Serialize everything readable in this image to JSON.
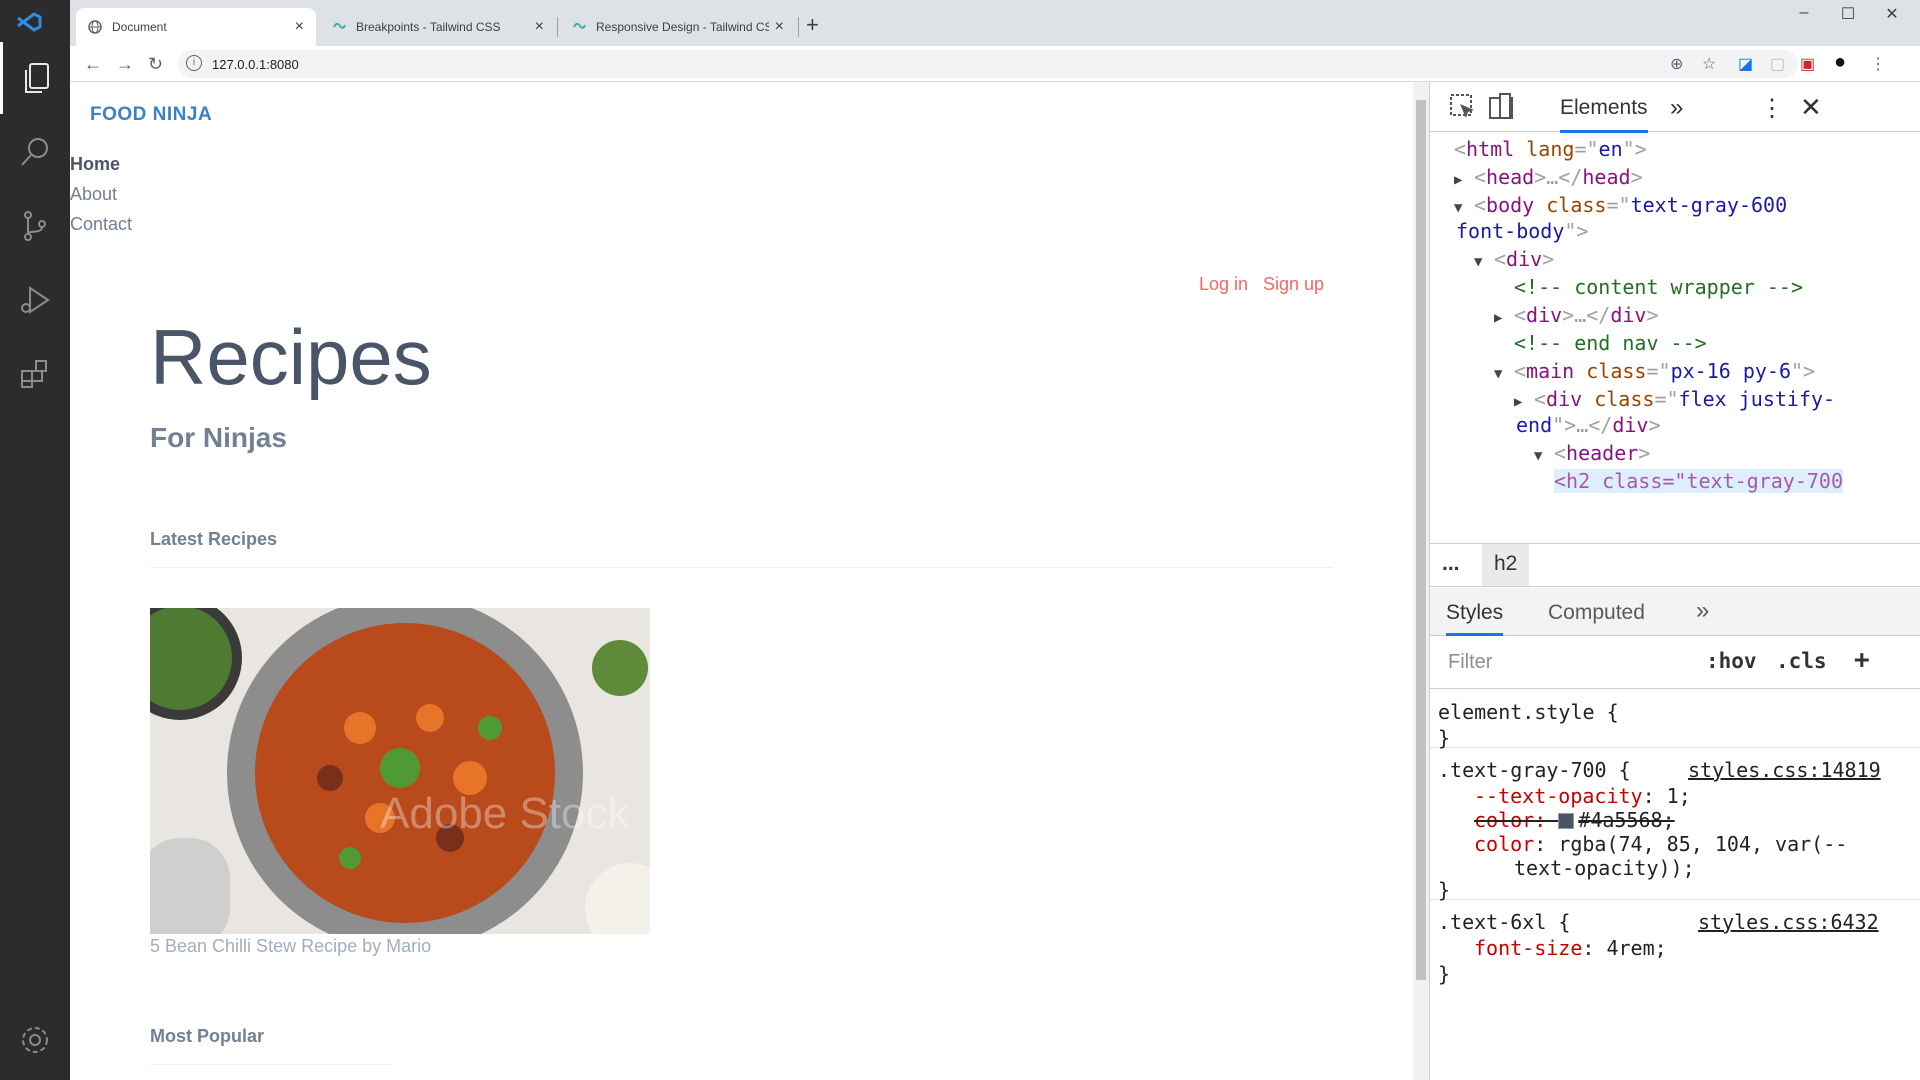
{
  "activity_bar": {
    "items": [
      {
        "name": "explorer-icon",
        "active": true
      },
      {
        "name": "search-icon",
        "active": false
      },
      {
        "name": "source-control-icon",
        "active": false
      },
      {
        "name": "run-debug-icon",
        "active": false
      },
      {
        "name": "extensions-icon",
        "active": false
      },
      {
        "name": "settings-gear-icon",
        "active": false
      }
    ]
  },
  "browser": {
    "tabs": [
      {
        "label": "Document",
        "active": true
      },
      {
        "label": "Breakpoints - Tailwind CSS",
        "active": false
      },
      {
        "label": "Responsive Design - Tailwind CSS",
        "active": false
      }
    ],
    "url": "127.0.0.1:8080"
  },
  "page": {
    "brand": "FOOD NINJA",
    "nav": [
      "Home",
      "About",
      "Contact"
    ],
    "login": "Log in",
    "signup": "Sign up",
    "title": "Recipes",
    "subtitle": "For Ninjas",
    "latest_heading": "Latest Recipes",
    "recipe_caption": "5 Bean Chilli Stew Recipe by Mario",
    "watermark": "Adobe Stock",
    "popular_heading": "Most Popular"
  },
  "devtools": {
    "panel_tab": "Elements",
    "more": "»",
    "dom": {
      "html_tag": "html",
      "lang_attr": "lang",
      "lang_val": "en",
      "head": "head",
      "body": "body",
      "body_class_attr": "class",
      "body_class_1": "text-gray-600",
      "body_class_2": "font-body",
      "div": "div",
      "comment_content": "<!-- content wrapper -->",
      "comment_nav": "<!-- end nav -->",
      "main": "main",
      "main_class": "px-16 py-6",
      "flex_class_1": "flex justify-",
      "flex_class_2": "end",
      "header": "header",
      "h2_partial": "<h2 class=\"text-gray-700"
    },
    "breadcrumb": {
      "dots": "...",
      "current": "h2"
    },
    "styles_tabs": {
      "styles": "Styles",
      "computed": "Computed",
      "more": "»"
    },
    "filter_placeholder": "Filter",
    "hov": ":hov",
    "cls": ".cls",
    "plus": "+",
    "rules": {
      "element_style": "element.style {",
      "close": "}",
      "r1_selector": ".text-gray-700 {",
      "r1_source": "styles.css:14819",
      "r1_p1_name": "--text-opacity",
      "r1_p1_val": "1;",
      "r1_p2_name": "color:",
      "r1_p2_val": "#4a5568;",
      "r1_p3_name": "color",
      "r1_p3_val": "rgba(74, 85, 104, var(--",
      "r1_p3_cont": "text-opacity));",
      "r2_selector": ".text-6xl {",
      "r2_source": "styles.css:6432",
      "r2_p1_name": "font-size",
      "r2_p1_val": "4rem;"
    },
    "swatch_color": "#4a5568"
  },
  "colors": {
    "brand": "#3b82c4",
    "auth": "#f56565",
    "title": "#4a5568",
    "vscode_blue": "#2d8ee0"
  }
}
